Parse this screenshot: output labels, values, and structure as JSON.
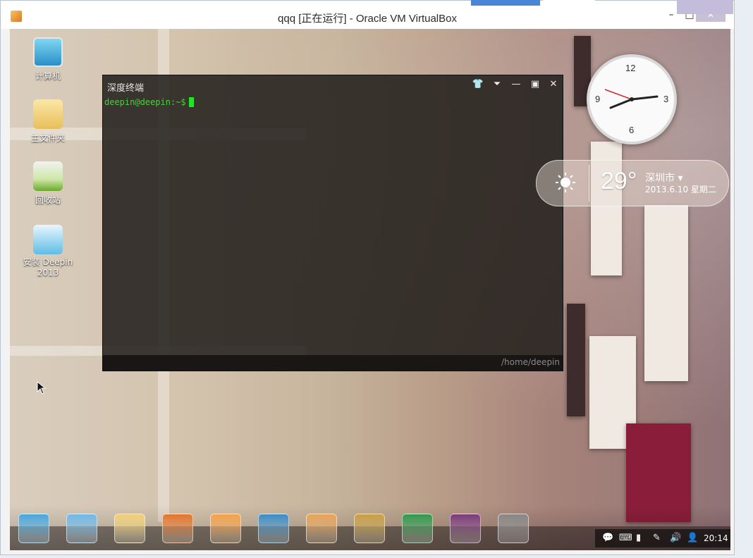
{
  "window": {
    "title": "qqq [正在运行] - Oracle VM VirtualBox",
    "min_label": "–",
    "max_label": "□",
    "close_label": "✕"
  },
  "desktop_icons": [
    {
      "label": "计算机",
      "icon": "computer-icon"
    },
    {
      "label": "主文件夹",
      "icon": "home-folder-icon"
    },
    {
      "label": "回收站",
      "icon": "trash-icon"
    },
    {
      "label": "安装 Deepin 2013",
      "icon": "deepin-installer-icon"
    }
  ],
  "terminal": {
    "title": "深度终端",
    "prompt": "deepin@deepin:~$",
    "path": "/home/deepin",
    "buttons": [
      "skin-icon",
      "dropdown-icon",
      "minimize-icon",
      "maximize-icon",
      "close-icon"
    ]
  },
  "clock": {
    "n12": "12",
    "n3": "3",
    "n6": "6",
    "n9": "9"
  },
  "weather": {
    "temperature": "29°",
    "city": "深圳市 ▾",
    "date": "2013.6.10 星期二"
  },
  "dock": {
    "items": [
      "deepin-launcher-icon",
      "picture-viewer-icon",
      "home-folder-icon",
      "firefox-icon",
      "music-player-icon",
      "video-player-icon",
      "software-center-icon",
      "game-icon",
      "system-monitor-icon",
      "deepin-terminal-icon",
      "system-settings-icon"
    ],
    "colors": [
      "#47a7e0",
      "#6fb8e8",
      "#f0cf78",
      "#e4742b",
      "#f3a24a",
      "#3c8dc9",
      "#e6a45a",
      "#c9a046",
      "#2f9a4f",
      "#7a3b7d",
      "#888888"
    ]
  },
  "tray": {
    "icons": [
      "chat-icon",
      "keyboard-icon",
      "battery-icon",
      "pen-icon",
      "volume-icon",
      "user-icon"
    ],
    "glyphs": [
      "💬",
      "⌨",
      "▮",
      "✎",
      "🔊",
      "👤"
    ],
    "time": "20:14"
  }
}
